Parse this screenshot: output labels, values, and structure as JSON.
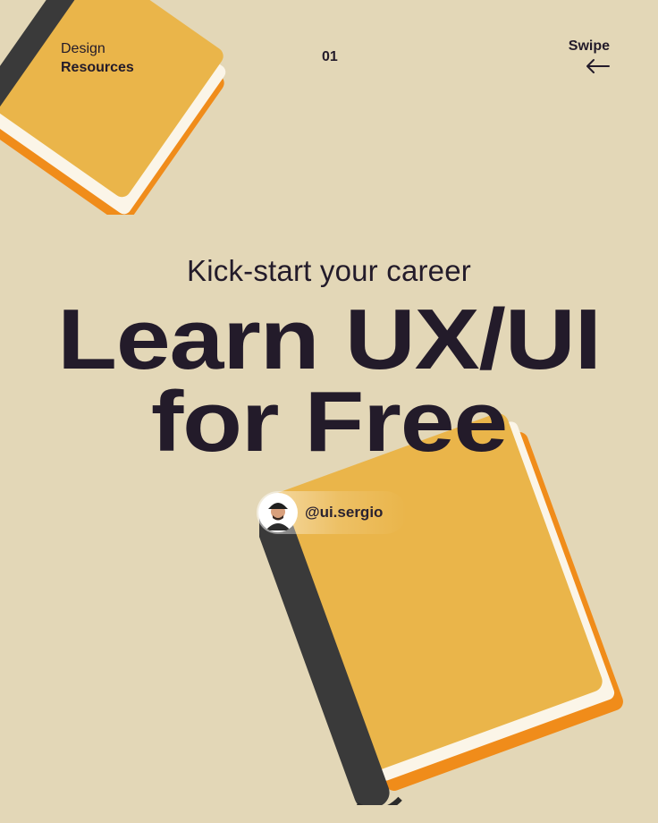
{
  "header": {
    "brand_line1": "Design",
    "brand_line2": "Resources",
    "page_number": "01",
    "swipe_label": "Swipe"
  },
  "hero": {
    "subtitle": "Kick-start your career",
    "headline_line1": "Learn UX/UI",
    "headline_line2": "for Free"
  },
  "author": {
    "handle": "@ui.sergio"
  },
  "icons": {
    "swipe": "arrow-left-icon",
    "book": "book-icon"
  },
  "colors": {
    "background": "#e3d7b7",
    "text": "#231b2a",
    "book_cover": "#eab54a",
    "book_edge": "#f08c1a",
    "book_spine": "#3a3a3a"
  }
}
